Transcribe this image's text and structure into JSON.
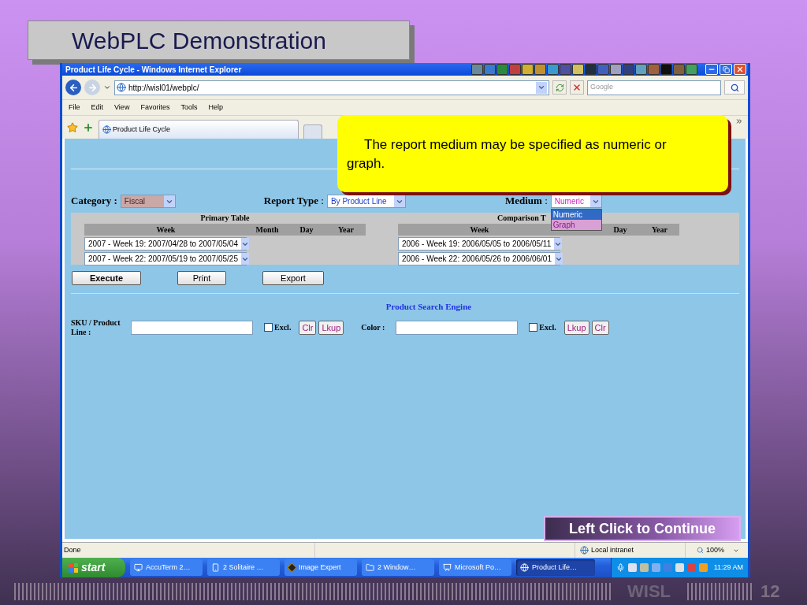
{
  "slide": {
    "title": "WebPLC Demonstration",
    "footer_label": "WISL",
    "page_number": "12"
  },
  "browser": {
    "window_title": "Product Life Cycle - Windows Internet Explorer",
    "address": "http://wisl01/webplc/",
    "search_placeholder": "Google",
    "menu": [
      "File",
      "Edit",
      "View",
      "Favorites",
      "Tools",
      "Help"
    ],
    "tabs": [
      {
        "label": "Product Life Cycle",
        "selected": true
      }
    ],
    "status": "Done",
    "zone": "Local intranet",
    "zoom": "100%"
  },
  "form": {
    "category": {
      "label": "Category :",
      "value": "Fiscal"
    },
    "report_type": {
      "label": "**Report Type** :",
      "value": "By Product Line"
    },
    "medium": {
      "label": "**Medium** :",
      "value": "Numeric",
      "options": [
        {
          "label": "Numeric",
          "selected": true
        },
        {
          "label": "Graph",
          "selected": false
        }
      ]
    },
    "primary_table": {
      "title": "Primary Table",
      "columns": [
        "Week",
        "Month",
        "Day",
        "Year"
      ],
      "selects": [
        "2007 - Week 19: 2007/04/28 to 2007/05/04",
        "2007 - Week 22: 2007/05/19 to 2007/05/25"
      ]
    },
    "comparison_table": {
      "title": "Comparison T",
      "columns": [
        "Week",
        "Day",
        "Year"
      ],
      "selects": [
        "2006 - Week 19: 2006/05/05 to 2006/05/11",
        "2006 - Week 22: 2006/05/26 to 2006/06/01"
      ]
    },
    "buttons": [
      "Execute",
      "Print",
      "Export"
    ],
    "search": {
      "title": "Product Search Engine",
      "fields": [
        {
          "label": "SKU / Product Line :",
          "excl_label": "Excl.",
          "excl_checked": false,
          "buttons": [
            "Clr",
            "Lkup"
          ]
        },
        {
          "label": "Color :",
          "excl_label": "Excl.",
          "excl_checked": false,
          "buttons": [
            "Lkup",
            "Clr"
          ]
        }
      ]
    }
  },
  "callout": {
    "text": "The report medium may be specified as numeric or graph."
  },
  "continue_button": "Left Click to Continue",
  "taskbar": {
    "start": "start",
    "items": [
      {
        "label": "AccuTerm 2…",
        "selected": false
      },
      {
        "label": "2 Solitaire …",
        "selected": false
      },
      {
        "label": "Image Expert",
        "selected": false
      },
      {
        "label": "2 Window…",
        "selected": false
      },
      {
        "label": "Microsoft Po…",
        "selected": false
      },
      {
        "label": "Product Life…",
        "selected": true
      }
    ],
    "clock": "11:29 AM"
  }
}
